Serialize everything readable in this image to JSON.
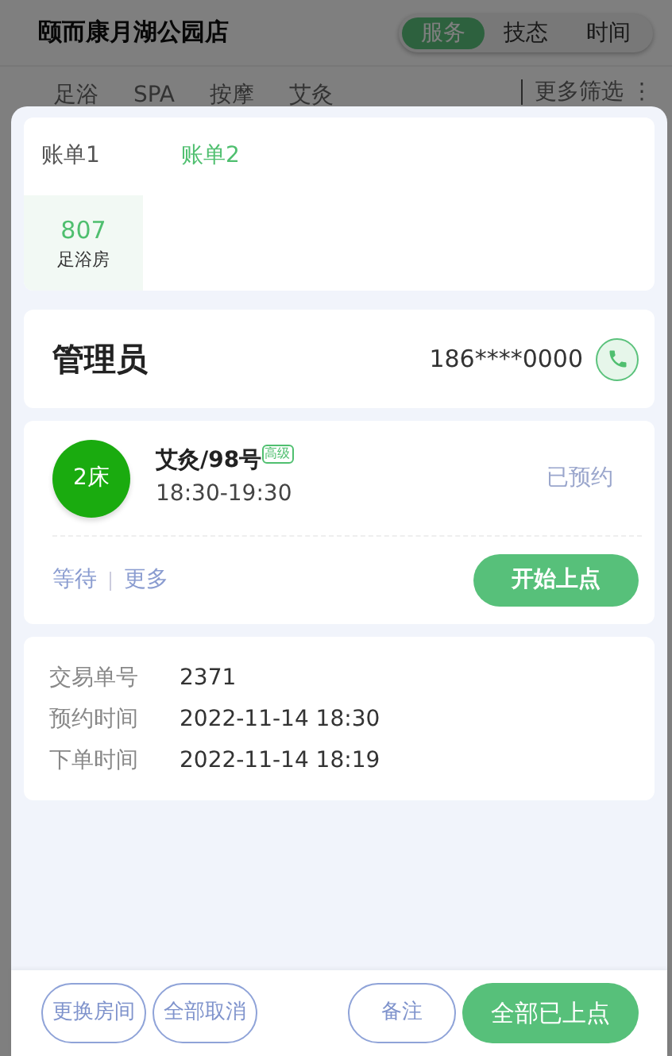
{
  "store": {
    "name": "颐而康月湖公园店"
  },
  "segments": [
    {
      "label": "服务",
      "selected": true
    },
    {
      "label": "技态",
      "selected": false
    },
    {
      "label": "时间",
      "selected": false
    }
  ],
  "filters": [
    "足浴",
    "SPA",
    "按摩",
    "艾灸"
  ],
  "more_filter": "更多筛选 ⋮",
  "bill_tabs": [
    {
      "label": "账单1",
      "selected": false
    },
    {
      "label": "账单2",
      "selected": true
    }
  ],
  "rooms": [
    {
      "number": "807",
      "type": "足浴房",
      "selected": true
    }
  ],
  "manager": {
    "title": "管理员",
    "phone": "186****0000"
  },
  "service": {
    "bed": "2床",
    "name": "艾灸/98号",
    "tag": "高级",
    "time": "18:30-19:30",
    "status": "已预约",
    "actions": [
      "等待",
      "更多"
    ],
    "button": "开始上点"
  },
  "details": [
    {
      "label": "交易单号",
      "value": "2371"
    },
    {
      "label": "预约时间",
      "value": "2022-11-14 18:30"
    },
    {
      "label": "下单时间",
      "value": "2022-11-14 18:19"
    }
  ],
  "footer_buttons": [
    {
      "label": "更换房间",
      "kind": "outline"
    },
    {
      "label": "全部取消",
      "kind": "outline"
    },
    {
      "label": "备注",
      "kind": "outline"
    },
    {
      "label": "全部已上点",
      "kind": "primary"
    }
  ]
}
